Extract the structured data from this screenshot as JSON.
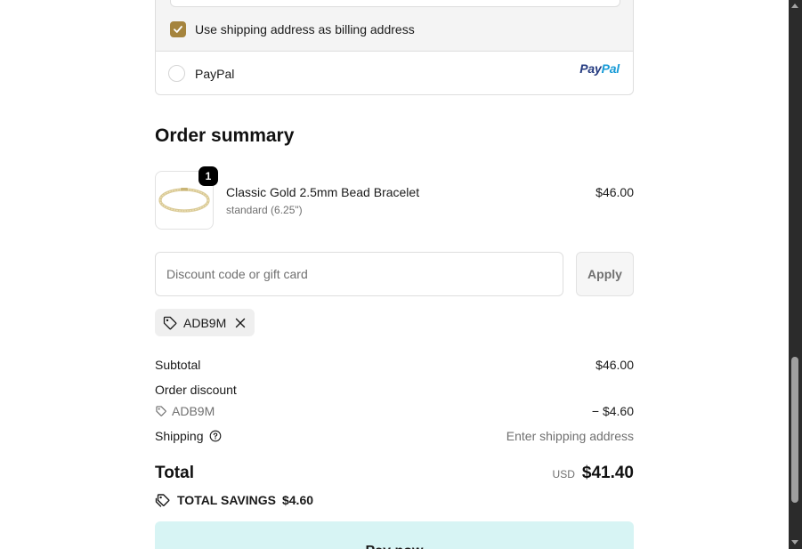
{
  "payment": {
    "billing_checkbox_label": "Use shipping address as billing address",
    "billing_checked": true,
    "paypal_label": "PayPal",
    "paypal_logo_part1": "Pay",
    "paypal_logo_part2": "Pal"
  },
  "summary": {
    "title": "Order summary",
    "items": [
      {
        "quantity": "1",
        "name": "Classic Gold 2.5mm Bead Bracelet",
        "variant": "standard (6.25\")",
        "price": "$46.00"
      }
    ],
    "discount_placeholder": "Discount code or gift card",
    "apply_label": "Apply",
    "applied_code": "ADB9M"
  },
  "totals": {
    "subtotal_label": "Subtotal",
    "subtotal_value": "$46.00",
    "order_discount_label": "Order discount",
    "discount_code": "ADB9M",
    "discount_amount": "− $4.60",
    "shipping_label": "Shipping",
    "shipping_value": "Enter shipping address",
    "total_label": "Total",
    "currency": "USD",
    "total_value": "$41.40",
    "savings_label": "TOTAL SAVINGS",
    "savings_value": "$4.60"
  },
  "pay_button_label": "Pay now",
  "colors": {
    "checkbox": "#a5843d",
    "pay_button_bg": "#d7f4f4",
    "muted_text": "#707070"
  }
}
